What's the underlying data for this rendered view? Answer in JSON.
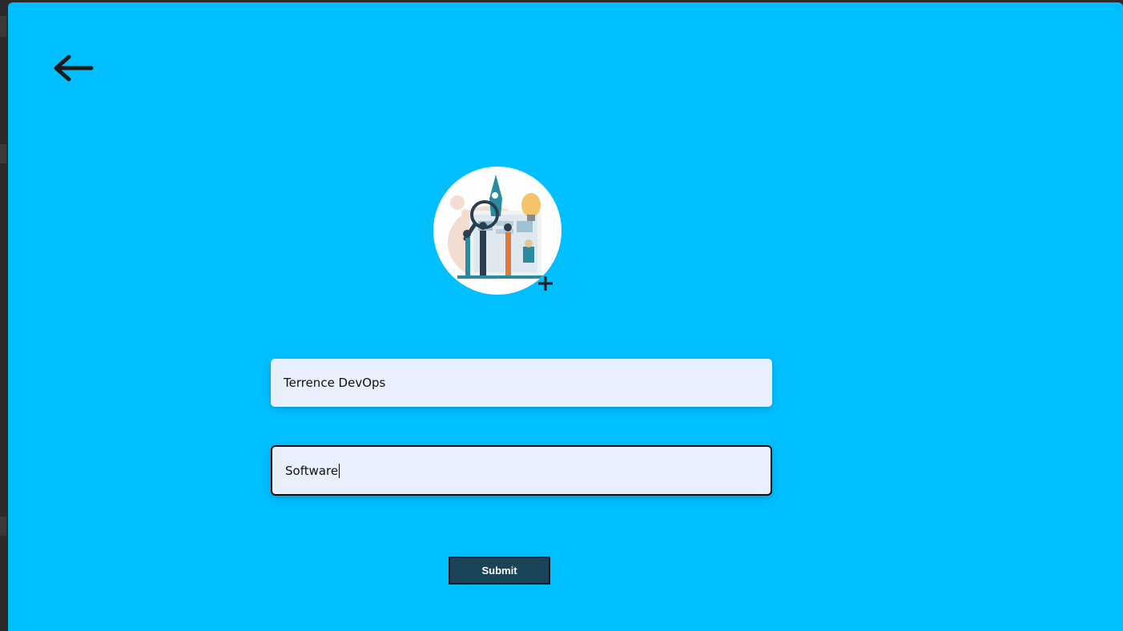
{
  "header": {
    "back_icon": "arrow-left-icon"
  },
  "profile": {
    "avatar_icon": "team-illustration",
    "add_photo_icon": "plus-icon"
  },
  "form": {
    "name_value": "Terrence DevOps",
    "department_value": "Software",
    "submit_label": "Submit"
  },
  "colors": {
    "background": "#00bfff",
    "input_bg": "#e8f0fe",
    "submit_bg": "#1a4559"
  }
}
